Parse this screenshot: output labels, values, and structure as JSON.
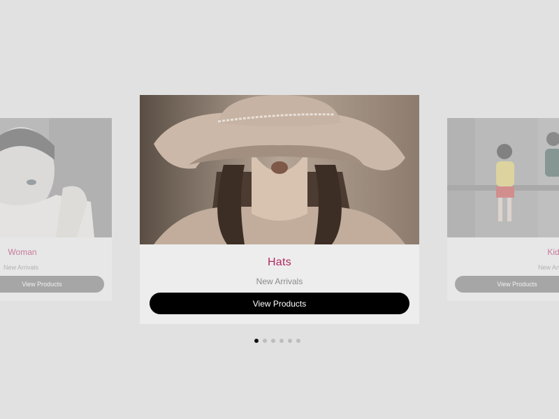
{
  "carousel": {
    "cards": [
      {
        "title": "Woman",
        "subtitle": "New Arrivals",
        "button": "View Products"
      },
      {
        "title": "Hats",
        "subtitle": "New Arrivals",
        "button": "View Products"
      },
      {
        "title": "Kids",
        "subtitle": "New Arrivals",
        "button": "View Products"
      }
    ],
    "active_index": 1,
    "dot_count": 6
  },
  "colors": {
    "background": "#e1e1e1",
    "card": "#ededed",
    "accent": "#b0285f",
    "button": "#000000"
  }
}
